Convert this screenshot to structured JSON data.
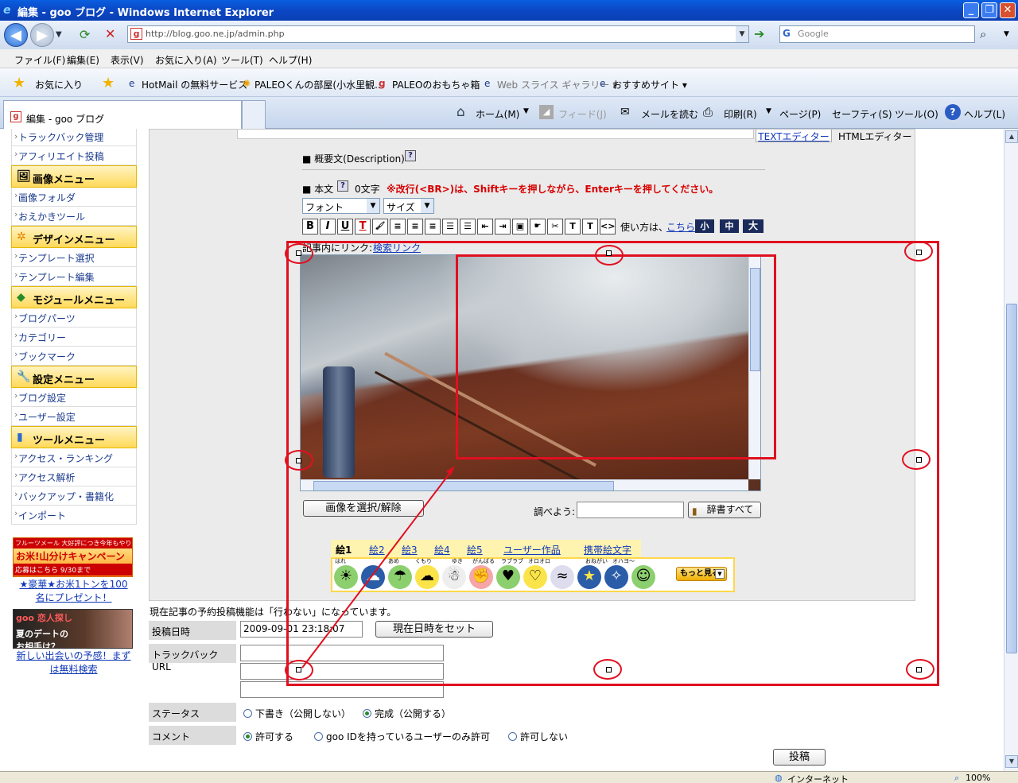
{
  "browser": {
    "title": "編集 - goo ブログ - Windows Internet Explorer",
    "url": "http://blog.goo.ne.jp/admin.php",
    "search_placeholder": "Google",
    "menu": [
      "ファイル(F)",
      "編集(E)",
      "表示(V)",
      "お気に入り(A)",
      "ツール(T)",
      "ヘルプ(H)"
    ],
    "favorites_label": "お気に入り",
    "favorites": [
      "HotMail の無料サービス",
      "PALEOくんの部屋(小水里観...",
      "PALEOのおもちゃ箱",
      "Web スライス ギャラリー ▾",
      "おすすめサイト ▾"
    ],
    "tab_title": "編集 - goo ブログ",
    "commands": [
      "ホーム(M)",
      "フィード(J)",
      "メールを読む",
      "印刷(R)",
      "ページ(P)",
      "セーフティ(S)",
      "ツール(O)",
      "ヘルプ(L)"
    ],
    "status_zone": "インターネット",
    "zoom": "100%"
  },
  "sidebar": {
    "top_items": [
      "トラックバック管理",
      "アフィリエイト投稿"
    ],
    "sections": [
      {
        "title": "画像メニュー",
        "items": [
          "画像フォルダ",
          "おえかきツール"
        ]
      },
      {
        "title": "デザインメニュー",
        "items": [
          "テンプレート選択",
          "テンプレート編集"
        ]
      },
      {
        "title": "モジュールメニュー",
        "items": [
          "ブログパーツ",
          "カテゴリー",
          "ブックマーク"
        ]
      },
      {
        "title": "設定メニュー",
        "items": [
          "ブログ設定",
          "ユーザー設定"
        ]
      },
      {
        "title": "ツールメニュー",
        "items": [
          "アクセス・ランキング",
          "アクセス解析",
          "バックアップ・書籍化",
          "インポート"
        ]
      }
    ],
    "ad1_banner_top": "フルーツメール 大好評につき今年もやります!",
    "ad1_banner_main": "お米!山分けキャンペーン",
    "ad1_banner_sub": "応募はこちら 9/30まで",
    "ad1_link": "★豪華★お米1トンを100名にプレゼント！",
    "ad2_banner_top": "goo 恋人探し",
    "ad2_banner_main": "夏のデートのお相手は？",
    "ad2_link": "新しい出会いの予感！まずは無料検索"
  },
  "editor": {
    "text_editor_tab": "TEXTエディター",
    "html_editor_tab": "HTMLエディター",
    "summary_label": "■ 概要文(Description)",
    "body_label": "■ 本文",
    "char_count": "0文字",
    "warning": "※改行(<BR>)は、Shiftキーを押しながら、Enterキーを押してください。",
    "font_select": "フォント",
    "size_select": "サイズ",
    "howto_label": "使い方は、",
    "howto_link": "こちら",
    "size_small": "小",
    "size_medium": "中",
    "size_large": "大",
    "inner_link_label": "記事内にリンク:",
    "inner_link": "検索リンク",
    "image_select_button": "画像を選択/解除",
    "lookup_label": "調べよう:",
    "dictionary_button": "辞書すべて",
    "emoji_tabs": [
      "絵1",
      "絵2",
      "絵3",
      "絵4",
      "絵5",
      "ユーザー作品",
      "携帯絵文字"
    ],
    "emoji_captions": [
      "はれ",
      "",
      "あめ",
      "くもり",
      "ゆき",
      "がんばる",
      "ラブラブ",
      "オロオロ",
      "",
      "おねがい",
      "オハヨ〜"
    ],
    "more_button": "もっと見る"
  },
  "form": {
    "schedule_note": "現在記事の予約投稿機能は「行わない」になっています。",
    "post_date_label": "投稿日時",
    "post_date_value": "2009-09-01 23:18:07",
    "set_now_button": "現在日時をセット",
    "trackback_label": "トラックバック URL",
    "status_label": "ステータス",
    "status_options": [
      "下書き（公開しない）",
      "完成（公開する）"
    ],
    "comment_label": "コメント",
    "comment_options": [
      "許可する",
      "goo IDを持っているユーザーのみ許可",
      "許可しない"
    ],
    "submit_button": "投稿"
  },
  "colors": {
    "annotation_red": "#e01020",
    "link_blue": "#1038b8",
    "warning_red": "#d80000"
  }
}
